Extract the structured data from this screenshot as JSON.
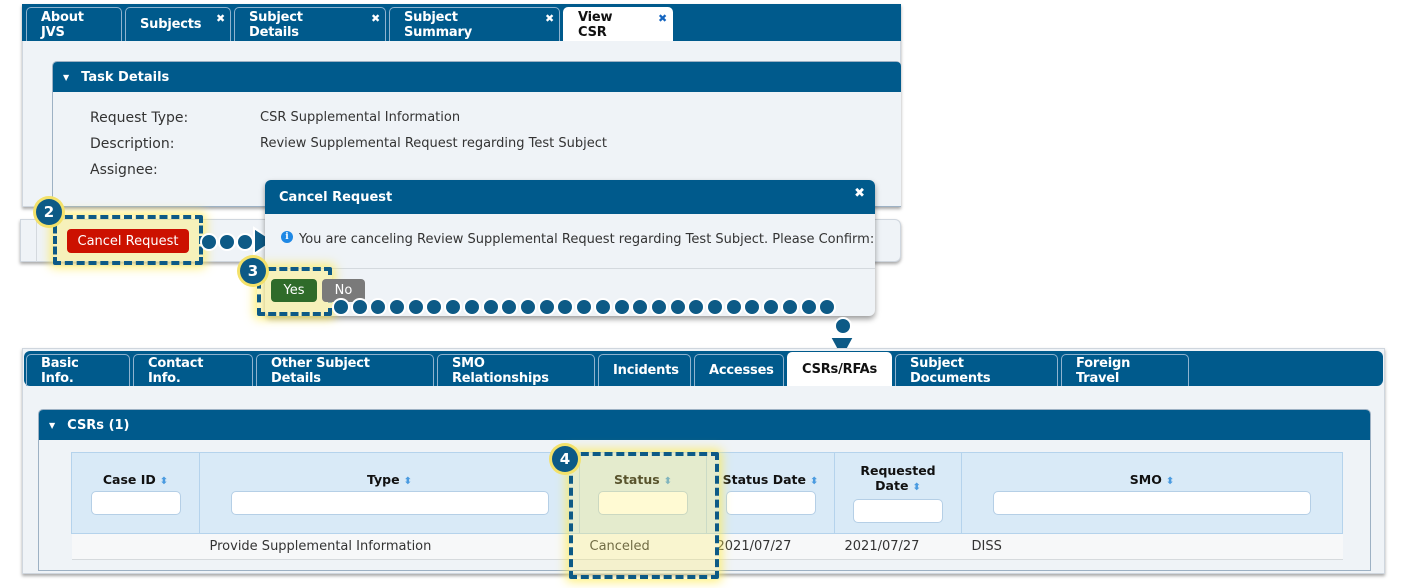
{
  "top_tabs": [
    {
      "label": "About JVS",
      "closable": false,
      "active": false
    },
    {
      "label": "Subjects",
      "closable": true,
      "active": false
    },
    {
      "label": "Subject Details",
      "closable": true,
      "active": false
    },
    {
      "label": "Subject Summary",
      "closable": true,
      "active": false
    },
    {
      "label": "View CSR",
      "closable": true,
      "active": true
    }
  ],
  "close_glyph": "✖",
  "task_details": {
    "title": "Task Details",
    "fields": [
      {
        "label": "Request Type:",
        "value": "CSR Supplemental Information"
      },
      {
        "label": "Description:",
        "value": "Review Supplemental Request regarding Test Subject"
      },
      {
        "label": "Assignee:",
        "value": ""
      }
    ]
  },
  "cancel_button_label": "Cancel Request",
  "dialog": {
    "title": "Cancel Request",
    "info_icon": "i",
    "message": "You are canceling Review Supplemental Request regarding Test Subject. Please Confirm:",
    "yes_label": "Yes",
    "no_label": "No"
  },
  "callouts": {
    "step2": "2",
    "step3": "3",
    "step4": "4"
  },
  "subject_tabs": [
    {
      "label": "Basic Info.",
      "active": false
    },
    {
      "label": "Contact Info.",
      "active": false
    },
    {
      "label": "Other Subject Details",
      "active": false
    },
    {
      "label": "SMO Relationships",
      "active": false
    },
    {
      "label": "Incidents",
      "active": false
    },
    {
      "label": "Accesses",
      "active": false
    },
    {
      "label": "CSRs/RFAs",
      "active": true
    },
    {
      "label": "Subject Documents",
      "active": false
    },
    {
      "label": "Foreign Travel",
      "active": false
    }
  ],
  "csrs": {
    "title": "CSRs (1)",
    "columns": [
      "Case ID",
      "Type",
      "Status",
      "Status Date",
      "Requested Date",
      "SMO"
    ],
    "sort_glyph": "⬍",
    "rows": [
      {
        "case_id": "",
        "type": "Provide Supplemental Information",
        "status": "Canceled",
        "status_date": "2021/07/27",
        "requested_date": "2021/07/27",
        "smo": "DISS"
      }
    ]
  },
  "colors": {
    "primary": "#005a8c",
    "danger": "#cc1100",
    "success": "#2f6b2a",
    "highlight": "#f3e16a"
  }
}
